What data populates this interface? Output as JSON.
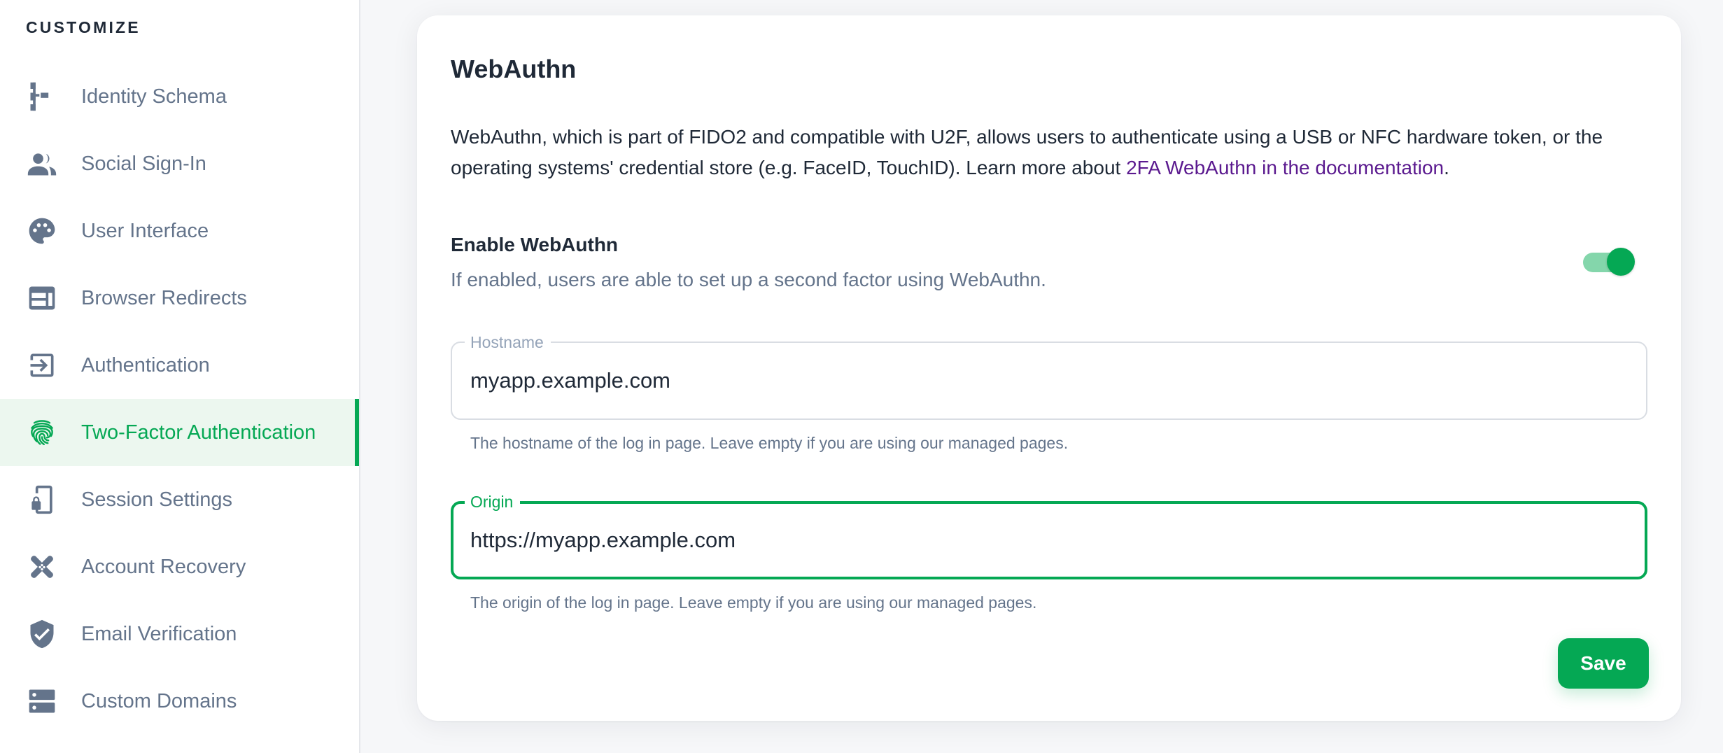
{
  "sidebar": {
    "heading": "CUSTOMIZE",
    "items": [
      {
        "label": "Identity Schema",
        "icon": "schema-icon",
        "active": false
      },
      {
        "label": "Social Sign-In",
        "icon": "users-icon",
        "active": false
      },
      {
        "label": "User Interface",
        "icon": "palette-icon",
        "active": false
      },
      {
        "label": "Browser Redirects",
        "icon": "browser-window-icon",
        "active": false
      },
      {
        "label": "Authentication",
        "icon": "sign-in-icon",
        "active": false
      },
      {
        "label": "Two-Factor Authentication",
        "icon": "fingerprint-icon",
        "active": true
      },
      {
        "label": "Session Settings",
        "icon": "phone-lock-icon",
        "active": false
      },
      {
        "label": "Account Recovery",
        "icon": "bandage-icon",
        "active": false
      },
      {
        "label": "Email Verification",
        "icon": "shield-check-icon",
        "active": false
      },
      {
        "label": "Custom Domains",
        "icon": "server-icon",
        "active": false
      }
    ]
  },
  "main": {
    "title": "WebAuthn",
    "description_prefix": "WebAuthn, which is part of FIDO2 and compatible with U2F, allows users to authenticate using a USB or NFC hardware token, or the operating systems' credential store (e.g. FaceID, TouchID). Learn more about ",
    "description_link": "2FA WebAuthn in the documentation",
    "description_suffix": ".",
    "toggle": {
      "title": "Enable WebAuthn",
      "description": "If enabled, users are able to set up a second factor using WebAuthn.",
      "enabled": true
    },
    "hostname": {
      "label": "Hostname",
      "value": "myapp.example.com",
      "helper": "The hostname of the log in page. Leave empty if you are using our managed pages."
    },
    "origin": {
      "label": "Origin",
      "value": "https://myapp.example.com",
      "helper": "The origin of the log in page. Leave empty if you are using our managed pages."
    },
    "save_label": "Save"
  },
  "colors": {
    "accent": "#05a854",
    "accent_light": "#ecf7ef",
    "link": "#5b1a8f",
    "muted": "#64748b",
    "text": "#1f2937"
  }
}
